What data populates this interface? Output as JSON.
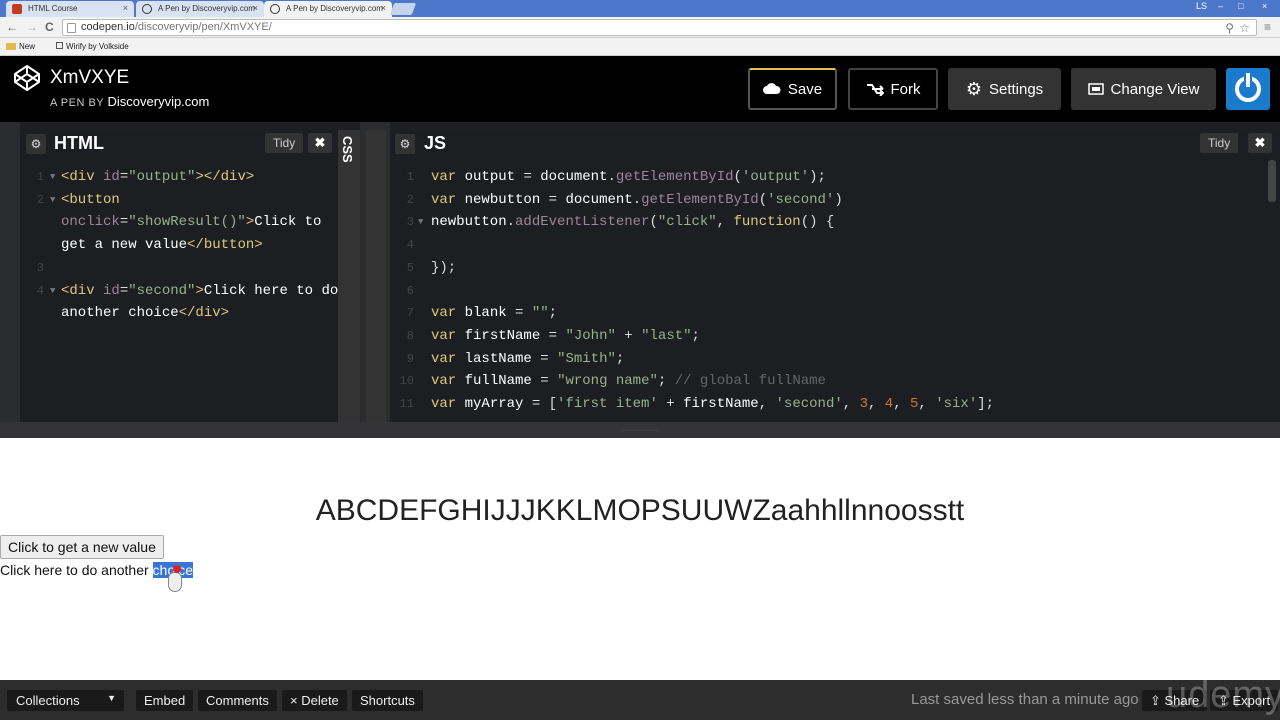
{
  "browser": {
    "tabs": [
      {
        "label": "HTML Course",
        "close": "×"
      },
      {
        "label": "A Pen by Discoveryvip.com",
        "close": "×"
      },
      {
        "label": "A Pen by Discoveryvip.com",
        "close": "×"
      }
    ],
    "window_user": "LS",
    "minimize": "–",
    "maximize": "□",
    "close": "×",
    "back": "←",
    "forward": "→",
    "reload": "C",
    "url_host": "codepen.io",
    "url_path": "/discoveryvip/pen/XmVXYE/",
    "bookmarks": [
      {
        "label": "New"
      },
      {
        "label": "Wirify by Volkside"
      }
    ]
  },
  "header": {
    "pen_title": "XmVXYE",
    "pen_by_prefix": "A PEN BY",
    "pen_author": "Discoveryvip.com",
    "save_label": "Save",
    "fork_label": "Fork",
    "settings_label": "Settings",
    "change_view_label": "Change View"
  },
  "html_panel": {
    "title": "HTML",
    "tidy_label": "Tidy",
    "close_label": "✖",
    "line_numbers": [
      "1",
      "2",
      "3",
      "4"
    ]
  },
  "css_panel": {
    "title": "CSS"
  },
  "js_panel": {
    "title": "JS",
    "tidy_label": "Tidy",
    "close_label": "✖",
    "line_numbers": [
      "1",
      "2",
      "3",
      "4",
      "5",
      "6",
      "7",
      "8",
      "9",
      "10",
      "11"
    ]
  },
  "output": {
    "heading": "ABCDEFGHIJJJKKLMOPSUUWZaahhllnnoosstt",
    "button_label": "Click to get a new value",
    "text_prefix": "Click here to do another ",
    "text_selected": "choice"
  },
  "footer": {
    "collections_label": "Collections",
    "embed_label": "Embed",
    "comments_label": "Comments",
    "delete_label": "× Delete",
    "shortcuts_label": "Shortcuts",
    "status": "Last saved less than a minute ago",
    "share_label": "Share",
    "export_label": "Export",
    "watermark": "udemy"
  },
  "colors": {
    "chrome_tabbar": "#4d77c8",
    "codepen_header": "#000000",
    "editor_bg": "#1d1e22",
    "accent_blue": "#1a7acc",
    "selection": "#3875d7"
  }
}
